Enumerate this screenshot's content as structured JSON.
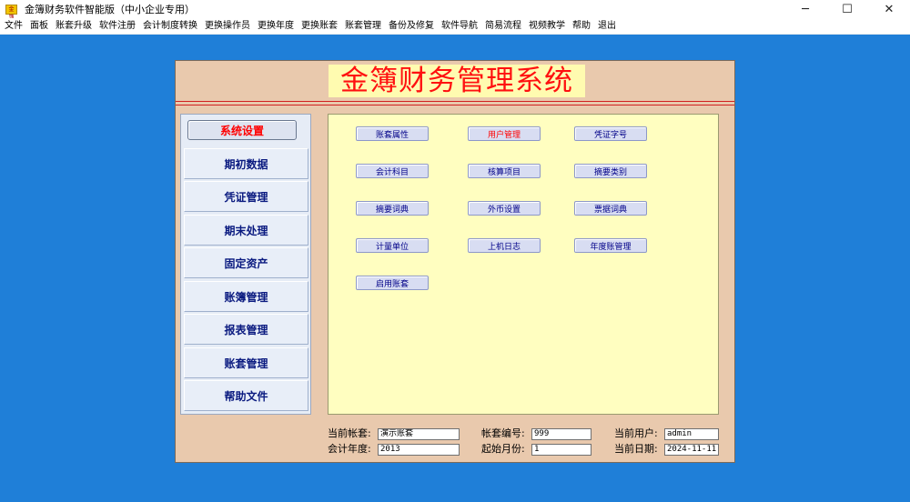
{
  "window": {
    "icon_text": "金簿",
    "title": "金簿财务软件智能版（中小企业专用）",
    "minimize": "─",
    "maximize": "☐",
    "close": "✕"
  },
  "menu": [
    "文件",
    "面板",
    "账套升级",
    "软件注册",
    "会计制度转换",
    "更换操作员",
    "更换年度",
    "更换账套",
    "账套管理",
    "备份及修复",
    "软件导航",
    "简易流程",
    "视频教学",
    "帮助",
    "退出"
  ],
  "system_title": "金簿财务管理系统",
  "nav": [
    "系统设置",
    "期初数据",
    "凭证管理",
    "期末处理",
    "固定资产",
    "账簿管理",
    "报表管理",
    "账套管理",
    "帮助文件"
  ],
  "functions": [
    [
      "账套属性",
      "用户管理",
      "凭证字号"
    ],
    [
      "会计科目",
      "核算项目",
      "摘要类别"
    ],
    [
      "摘要词典",
      "外币设置",
      "票据词典"
    ],
    [
      "计量单位",
      "上机日志",
      "年度账管理"
    ],
    [
      "启用账套"
    ]
  ],
  "status": {
    "current_set_label": "当前帐套:",
    "current_set_value": "演示账套",
    "set_no_label": "帐套编号:",
    "set_no_value": "999",
    "current_user_label": "当前用户:",
    "current_user_value": "admin",
    "year_label": "会计年度:",
    "year_value": "2013",
    "start_month_label": "起始月份:",
    "start_month_value": "1",
    "current_date_label": "当前日期:",
    "current_date_value": "2024-11-11"
  },
  "colors": {
    "desktop": "#1f7fd8",
    "panel": "#e9c9ad",
    "title_bg": "#fffbb0",
    "title_text": "#ff1010",
    "content_bg": "#fffec0",
    "nav_text": "#0a1a80",
    "active": "#ff0000"
  }
}
